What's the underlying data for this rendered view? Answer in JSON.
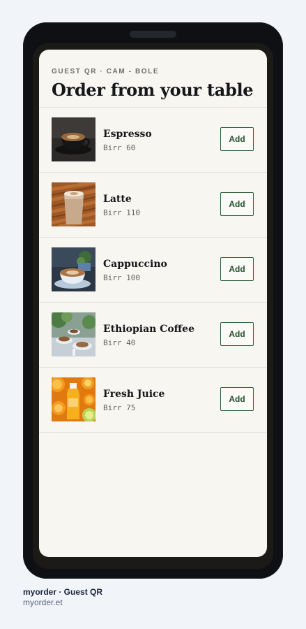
{
  "header": {
    "eyebrow": "GUEST QR · CAM - BOLE",
    "title": "Order from your table"
  },
  "menu": {
    "add_label": "Add",
    "items": [
      {
        "name": "Espresso",
        "price": "Birr 60",
        "image_icon": "espresso-photo"
      },
      {
        "name": "Latte",
        "price": "Birr 110",
        "image_icon": "latte-photo"
      },
      {
        "name": "Cappuccino",
        "price": "Birr 100",
        "image_icon": "cappuccino-photo"
      },
      {
        "name": "Ethiopian Coffee",
        "price": "Birr 40",
        "image_icon": "ethiopian-coffee-photo"
      },
      {
        "name": "Fresh Juice",
        "price": "Birr 75",
        "image_icon": "fresh-juice-photo"
      }
    ]
  },
  "footer": {
    "brand": "myorder · Guest QR",
    "url": "myorder.et"
  },
  "colors": {
    "page_bg": "#f1f5fa",
    "screen_bg": "#f8f6f1",
    "accent_green": "#2f5f3a",
    "device": "#0e1013"
  }
}
